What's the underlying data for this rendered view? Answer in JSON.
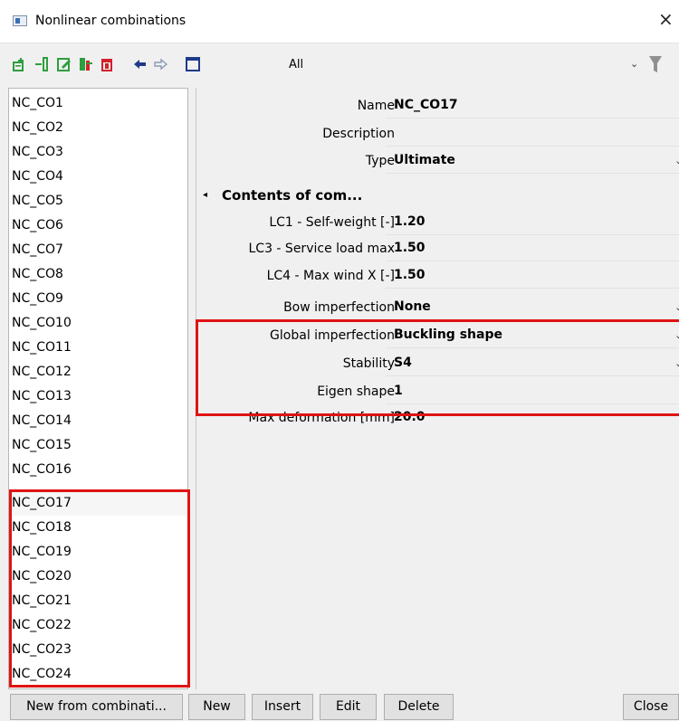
{
  "window": {
    "title": "Nonlinear combinations",
    "close_glyph": "×"
  },
  "toolbar": {
    "icons": [
      "add-combination-icon",
      "insert-icon",
      "edit-icon",
      "copy-icon",
      "delete-icon",
      "undo-icon",
      "redo-icon",
      "window-icon"
    ],
    "filter_value": "All",
    "chevron": "⌄"
  },
  "combinations": {
    "items": [
      "NC_CO1",
      "NC_CO2",
      "NC_CO3",
      "NC_CO4",
      "NC_CO5",
      "NC_CO6",
      "NC_CO7",
      "NC_CO8",
      "NC_CO9",
      "NC_CO10",
      "NC_CO11",
      "NC_CO12",
      "NC_CO13",
      "NC_CO14",
      "NC_CO15",
      "NC_CO16",
      "NC_CO17",
      "NC_CO18",
      "NC_CO19",
      "NC_CO20",
      "NC_CO21",
      "NC_CO22",
      "NC_CO23",
      "NC_CO24"
    ],
    "selected": "NC_CO17"
  },
  "properties": {
    "name": {
      "label": "Name",
      "value": "NC_CO17"
    },
    "description": {
      "label": "Description",
      "value": ""
    },
    "type": {
      "label": "Type",
      "value": "Ultimate"
    },
    "section": {
      "toggle": "◂",
      "label": "Contents of com..."
    },
    "lc1": {
      "label": "LC1 - Self-weight [-]",
      "value": "1.20"
    },
    "lc3": {
      "label": "LC3 - Service load max",
      "value": "1.50"
    },
    "lc4": {
      "label": "LC4 - Max wind X [-]",
      "value": "1.50"
    },
    "bow": {
      "label": "Bow imperfection",
      "value": "None"
    },
    "global": {
      "label": "Global imperfection",
      "value": "Buckling shape"
    },
    "stability": {
      "label": "Stability",
      "value": "S4"
    },
    "eigen": {
      "label": "Eigen shape",
      "value": "1"
    },
    "maxdef": {
      "label": "Max deformation [mm]",
      "value": "20.0"
    },
    "dropdown_arrow": "⌄"
  },
  "buttons": {
    "new_from": "New from combinati...",
    "new": "New",
    "insert": "Insert",
    "edit": "Edit",
    "delete": "Delete",
    "close": "Close"
  },
  "colors": {
    "highlight_border": "#e01313",
    "toolbar_green": "#2e9e3e",
    "toolbar_red": "#d3202a",
    "toolbar_navy": "#1f3a8a"
  }
}
